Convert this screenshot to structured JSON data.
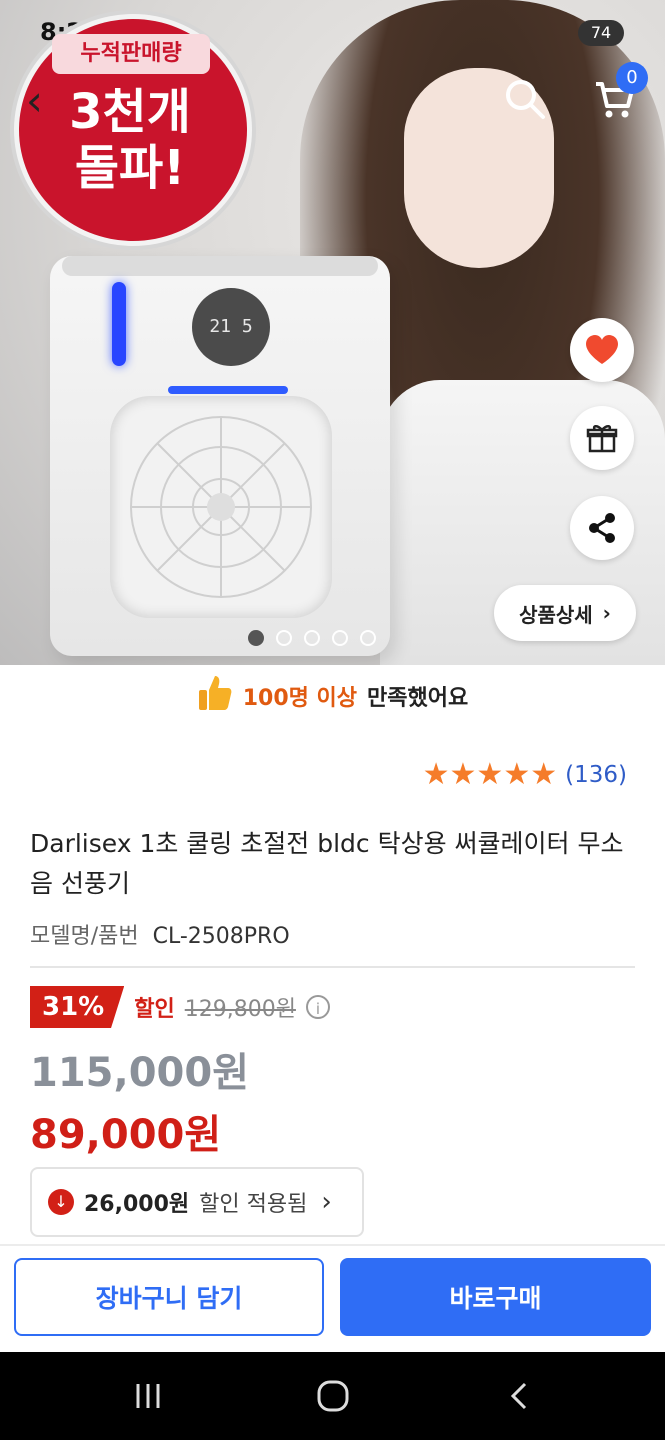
{
  "status_bar": {
    "time": "8:24",
    "battery": "74"
  },
  "hero": {
    "badge_top": "누적판매량",
    "badge_main_line1": "3천개",
    "badge_main_line2": "돌파!",
    "fan_display": "21 5",
    "cart_count": "0",
    "detail_label": "상품상세",
    "dots_total": 5,
    "dots_active_index": 0
  },
  "satisfaction": {
    "highlight": "100명 이상",
    "rest": "만족했어요"
  },
  "rating": {
    "stars": 5,
    "reviews": "(136)"
  },
  "product": {
    "title": "Darlisex 1초 쿨링 초절전 bldc 탁상용 써큘레이터 무소음 선풍기",
    "model_label": "모델명/품번",
    "model_value": "CL-2508PRO"
  },
  "pricing": {
    "discount_pct": "31%",
    "discount_label": "할인",
    "original_price": "129,800원",
    "list_price": "115,000원",
    "final_price": "89,000원",
    "coupon_amount": "26,000원",
    "coupon_text": "할인 적용됨"
  },
  "actions": {
    "add_to_cart": "장바구니 담기",
    "buy_now": "바로구매"
  },
  "colors": {
    "accent_blue": "#2f6df5",
    "sale_red": "#d22016",
    "star_orange": "#f57c2a"
  }
}
